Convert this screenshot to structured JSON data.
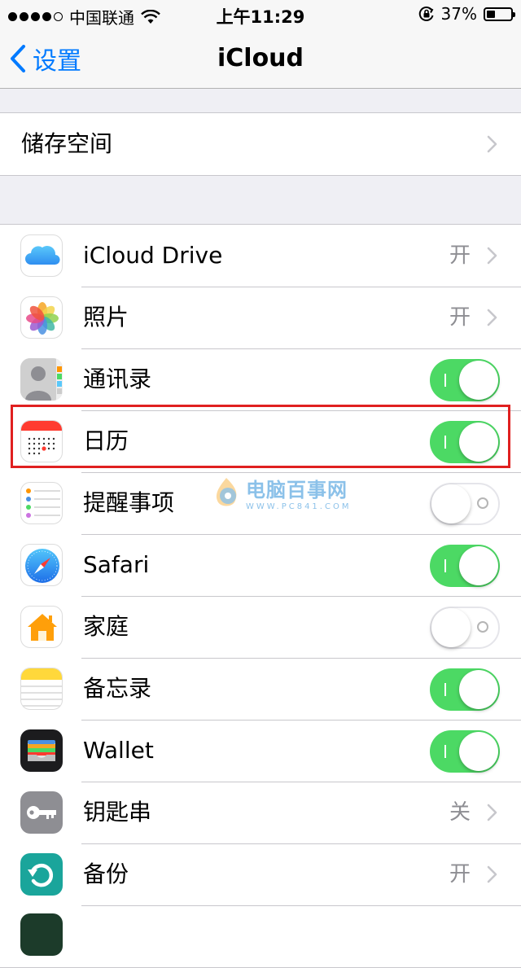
{
  "status_bar": {
    "carrier": "中国联通",
    "time": "上午11:29",
    "battery_percent": "37%",
    "battery_level": 0.37,
    "signal_bars": 4,
    "icons": [
      "wifi-icon",
      "rotation-lock-icon",
      "battery-icon"
    ]
  },
  "nav": {
    "back_label": "设置",
    "title": "iCloud"
  },
  "storage": {
    "label": "储存空间"
  },
  "apps": [
    {
      "label": "iCloud Drive",
      "icon": "icloud-drive-icon",
      "control": "value",
      "value": "开"
    },
    {
      "label": "照片",
      "icon": "photos-icon",
      "control": "value",
      "value": "开"
    },
    {
      "label": "通讯录",
      "icon": "contacts-icon",
      "control": "switch",
      "on": true
    },
    {
      "label": "日历",
      "icon": "calendar-icon",
      "control": "switch",
      "on": true
    },
    {
      "label": "提醒事项",
      "icon": "reminders-icon",
      "control": "switch",
      "on": false
    },
    {
      "label": "Safari",
      "icon": "safari-icon",
      "control": "switch",
      "on": true
    },
    {
      "label": "家庭",
      "icon": "home-icon",
      "control": "switch",
      "on": false
    },
    {
      "label": "备忘录",
      "icon": "notes-icon",
      "control": "switch",
      "on": true
    },
    {
      "label": "Wallet",
      "icon": "wallet-icon",
      "control": "switch",
      "on": true
    },
    {
      "label": "钥匙串",
      "icon": "keychain-icon",
      "control": "value",
      "value": "关"
    },
    {
      "label": "备份",
      "icon": "backup-icon",
      "control": "value",
      "value": "开"
    }
  ],
  "watermark": {
    "title": "电脑百事网",
    "url": "WWW.PC841.COM"
  },
  "colors": {
    "accent": "#007aff",
    "switch_on": "#4cd964",
    "highlight": "#e02020",
    "background": "#efeff4"
  }
}
